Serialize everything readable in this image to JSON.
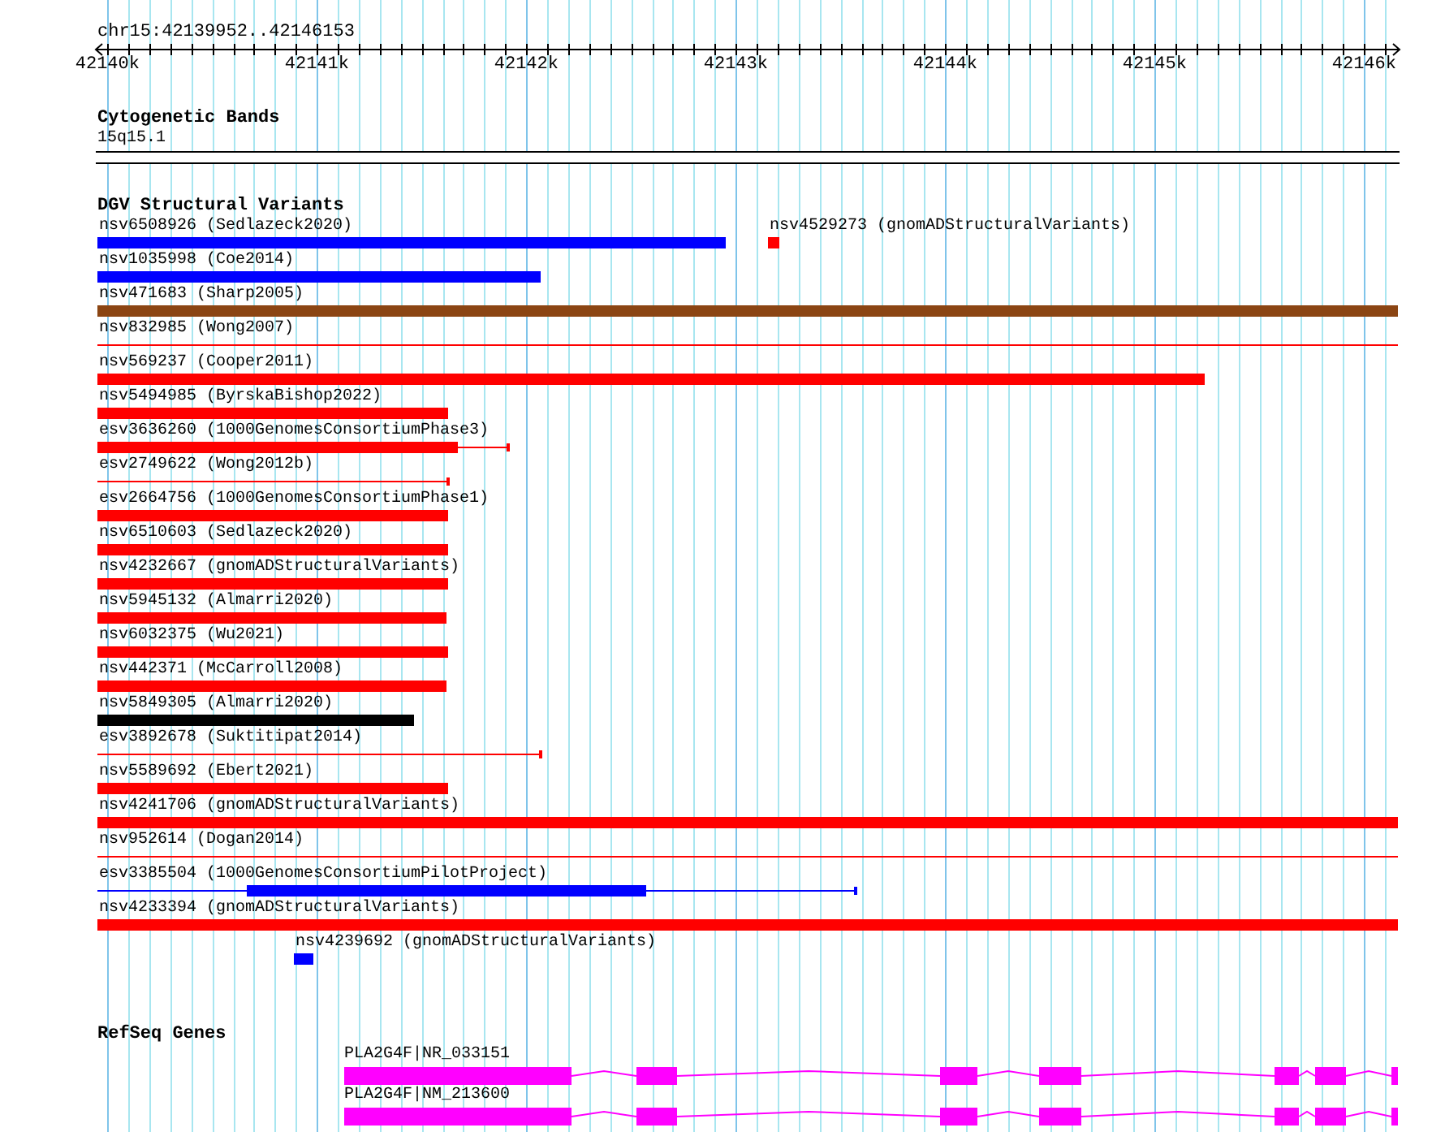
{
  "ruler": {
    "location": "chr15:42139952..42146153",
    "ticks": [
      "42140k",
      "42141k",
      "42142k",
      "42143k",
      "42144k",
      "42145k",
      "42146k"
    ]
  },
  "cytogenetic_bands": {
    "title": "Cytogenetic Bands",
    "band": "15q15.1"
  },
  "structural_variants": {
    "title": "DGV Structural Variants",
    "rows": [
      {
        "features": [
          {
            "label": "nsv6508926 (Sedlazeck2020)",
            "color": "#0000ff",
            "kind": "bar"
          },
          {
            "label": "nsv4529273 (gnomADStructuralVariants)",
            "color": "#ff0000",
            "kind": "bar"
          }
        ]
      },
      {
        "features": [
          {
            "label": "nsv1035998 (Coe2014)",
            "color": "#0000ff",
            "kind": "bar"
          }
        ]
      },
      {
        "features": [
          {
            "label": "nsv471683 (Sharp2005)",
            "color": "#8b4513",
            "kind": "bar"
          }
        ]
      },
      {
        "features": [
          {
            "label": "nsv832985 (Wong2007)",
            "color": "#ff0000",
            "kind": "line"
          }
        ]
      },
      {
        "features": [
          {
            "label": "nsv569237 (Cooper2011)",
            "color": "#ff0000",
            "kind": "bar"
          }
        ]
      },
      {
        "features": [
          {
            "label": "nsv5494985 (ByrskaBishop2022)",
            "color": "#ff0000",
            "kind": "bar"
          }
        ]
      },
      {
        "features": [
          {
            "label": "esv3636260 (1000GenomesConsortiumPhase3)",
            "color": "#ff0000",
            "kind": "bar_line"
          }
        ]
      },
      {
        "features": [
          {
            "label": "esv2749622 (Wong2012b)",
            "color": "#ff0000",
            "kind": "line"
          }
        ]
      },
      {
        "features": [
          {
            "label": "esv2664756 (1000GenomesConsortiumPhase1)",
            "color": "#ff0000",
            "kind": "bar"
          }
        ]
      },
      {
        "features": [
          {
            "label": "nsv6510603 (Sedlazeck2020)",
            "color": "#ff0000",
            "kind": "bar"
          }
        ]
      },
      {
        "features": [
          {
            "label": "nsv4232667 (gnomADStructuralVariants)",
            "color": "#ff0000",
            "kind": "bar"
          }
        ]
      },
      {
        "features": [
          {
            "label": "nsv5945132 (Almarri2020)",
            "color": "#ff0000",
            "kind": "bar"
          }
        ]
      },
      {
        "features": [
          {
            "label": "nsv6032375 (Wu2021)",
            "color": "#ff0000",
            "kind": "bar"
          }
        ]
      },
      {
        "features": [
          {
            "label": "nsv442371 (McCarroll2008)",
            "color": "#ff0000",
            "kind": "bar"
          }
        ]
      },
      {
        "features": [
          {
            "label": "nsv5849305 (Almarri2020)",
            "color": "#000000",
            "kind": "bar"
          }
        ]
      },
      {
        "features": [
          {
            "label": "esv3892678 (Suktitipat2014)",
            "color": "#ff0000",
            "kind": "line"
          }
        ]
      },
      {
        "features": [
          {
            "label": "nsv5589692 (Ebert2021)",
            "color": "#ff0000",
            "kind": "bar"
          }
        ]
      },
      {
        "features": [
          {
            "label": "nsv4241706 (gnomADStructuralVariants)",
            "color": "#ff0000",
            "kind": "bar"
          }
        ]
      },
      {
        "features": [
          {
            "label": "nsv952614 (Dogan2014)",
            "color": "#ff0000",
            "kind": "line"
          }
        ]
      },
      {
        "features": [
          {
            "label": "esv3385504 (1000GenomesConsortiumPilotProject)",
            "color": "#0000ff",
            "kind": "line_bar_line"
          }
        ]
      },
      {
        "features": [
          {
            "label": "nsv4233394 (gnomADStructuralVariants)",
            "color": "#ff0000",
            "kind": "bar"
          }
        ]
      },
      {
        "features": [
          {
            "label": "nsv4239692 (gnomADStructuralVariants)",
            "color": "#0000ff",
            "kind": "bar"
          }
        ]
      }
    ]
  },
  "refseq_genes": {
    "title": "RefSeq Genes",
    "genes": [
      {
        "label": "PLA2G4F|NR_033151",
        "color": "#ff00ff"
      },
      {
        "label": "PLA2G4F|NM_213600",
        "color": "#ff00ff"
      }
    ]
  }
}
